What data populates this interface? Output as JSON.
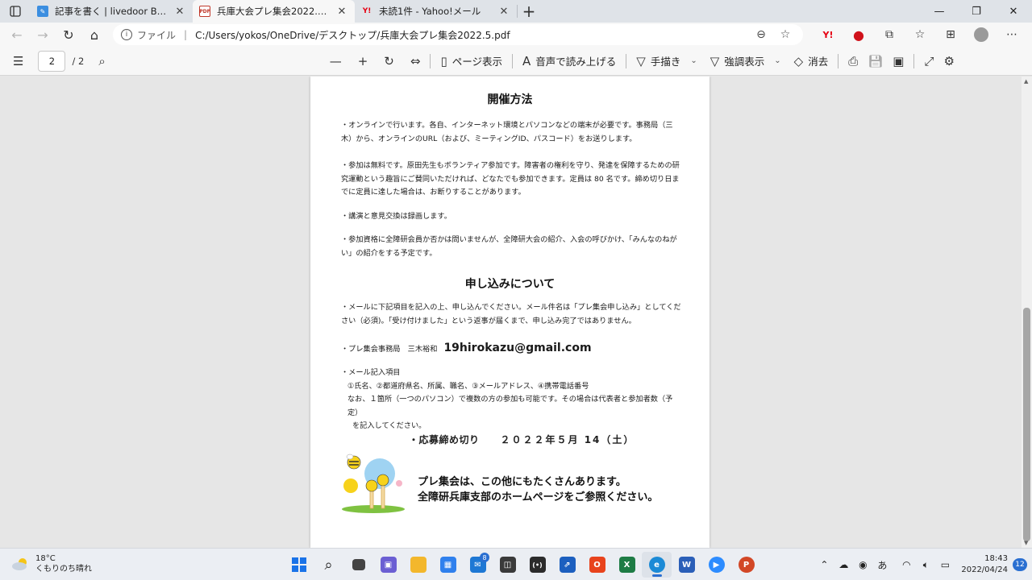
{
  "browser": {
    "tabs": [
      {
        "title": "記事を書く | livedoor Blog",
        "favicon": "livedoor-icon",
        "active": false
      },
      {
        "title": "兵庫大会プレ集会2022.5.pdf",
        "favicon": "pdf-icon",
        "active": true
      },
      {
        "title": "未読1件 - Yahoo!メール",
        "favicon": "yahoo-icon",
        "active": false
      }
    ],
    "address": {
      "scheme_label": "ファイル",
      "url": "C:/Users/yokos/OneDrive/デスクトップ/兵庫大会プレ集会2022.5.pdf"
    }
  },
  "pdf_toolbar": {
    "current_page": "2",
    "total_pages": "/ 2",
    "page_view_label": "ページ表示",
    "read_aloud_label": "音声で読み上げる",
    "draw_label": "手描き",
    "highlight_label": "強調表示",
    "erase_label": "消去"
  },
  "document": {
    "heading_method": "開催方法",
    "method_paragraphs": [
      "・オンラインで行います。各自、インターネット環境とパソコンなどの端末が必要です。事務局（三木）から、オンラインのURL（および、ミーティングID、パスコード）をお送りします。",
      "・参加は無料です。原田先生もボランティア参加です。障害者の権利を守り、発達を保障するための研究運動という趣旨にご賛同いただければ、どなたでも参加できます。定員は 80 名です。締め切り日までに定員に達した場合は、お断りすることがあります。",
      "・講演と意見交換は録画します。",
      "・参加資格に全障研会員か否かは問いませんが、全障研大会の紹介、入会の呼びかけ、「みんなのねがい」の紹介をする予定です。"
    ],
    "heading_apply": "申し込みについて",
    "apply_paragraph": "・メールに下記項目を記入の上、申し込んでください。メール件名は「プレ集会申し込み」としてください（必須)。「受け付けました」という返事が届くまで、申し込み完了ではありません。",
    "office_label": "・プレ集会事務局　三木裕和",
    "office_email": "19hirokazu@gmail.com",
    "mail_items_label": "・メール記入項目",
    "mail_items": "①氏名、②都道府県名、所属、職名、③メールアドレス、④携帯電話番号",
    "mail_note_1": "なお、１箇所（一つのパソコン）で複数の方の参加も可能です。その場合は代表者と参加者数（予定）",
    "mail_note_2": "を記入してください。",
    "deadline_label": "・応募締め切り",
    "deadline_date": "２０２２年５月 14（土）",
    "closing_line_1": "プレ集会は、この他にもたくさんあります。",
    "closing_line_2": "全障研兵庫支部のホームページをご参照ください。"
  },
  "taskbar": {
    "weather_temp": "18°C",
    "weather_desc": "くもりのち晴れ",
    "mail_badge": "8",
    "time": "18:43",
    "date": "2022/04/24",
    "notifications": "12",
    "ime": "あ"
  }
}
